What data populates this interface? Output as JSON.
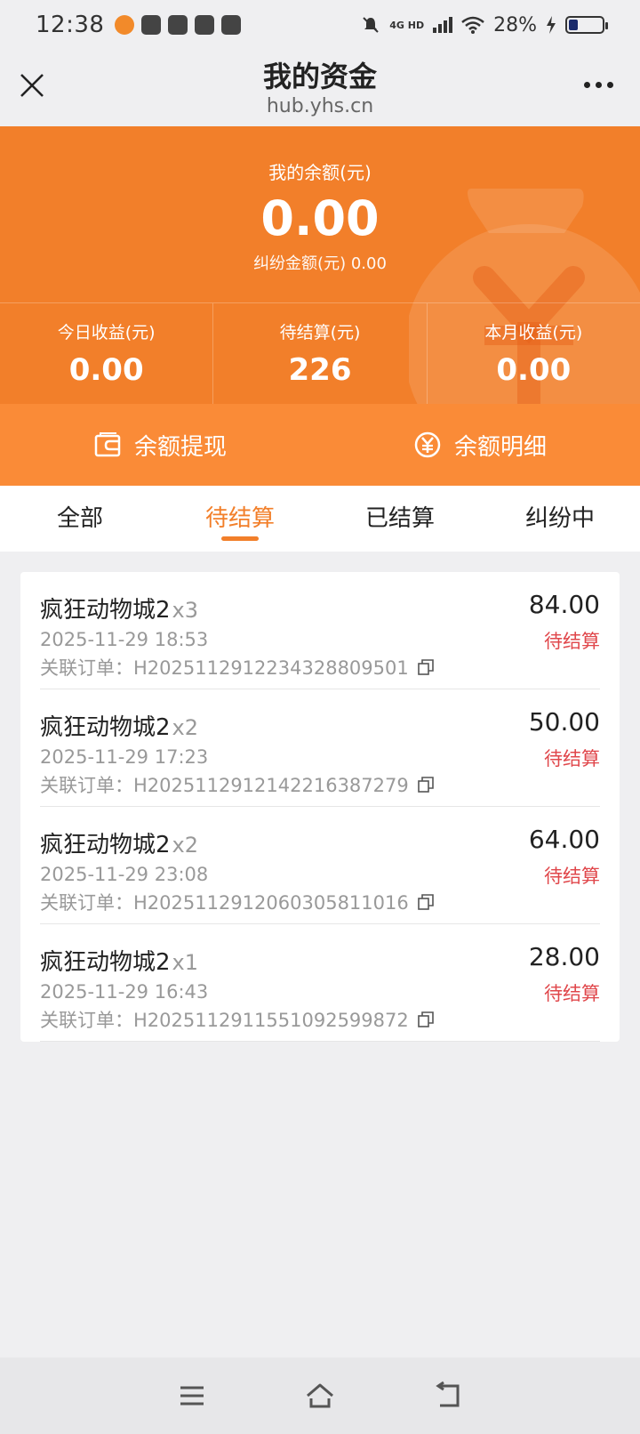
{
  "status_bar": {
    "time": "12:38",
    "network": "4G HD",
    "battery": "28%"
  },
  "header": {
    "title": "我的资金",
    "subtitle": "hub.yhs.cn"
  },
  "balance": {
    "label": "我的余额(元)",
    "amount": "0.00",
    "dispute_text": "纠纷金额(元) 0.00",
    "stats": [
      {
        "label": "今日收益(元)",
        "value": "0.00"
      },
      {
        "label": "待结算(元)",
        "value": "226"
      },
      {
        "label": "本月收益(元)",
        "value": "0.00"
      }
    ]
  },
  "actions": {
    "withdraw": "余额提现",
    "details": "余额明细"
  },
  "tabs": [
    "全部",
    "待结算",
    "已结算",
    "纠纷中"
  ],
  "active_tab": "待结算",
  "records": [
    {
      "name": "疯狂动物城2",
      "qty": "x3",
      "time": "2025-11-29 18:53",
      "order": "关联订单：H2025112912234328809501",
      "amount": "84.00",
      "status": "待结算"
    },
    {
      "name": "疯狂动物城2",
      "qty": "x2",
      "time": "2025-11-29 17:23",
      "order": "关联订单：H2025112912142216387279",
      "amount": "50.00",
      "status": "待结算"
    },
    {
      "name": "疯狂动物城2",
      "qty": "x2",
      "time": "2025-11-29 23:08",
      "order": "关联订单：H2025112912060305811016",
      "amount": "64.00",
      "status": "待结算"
    },
    {
      "name": "疯狂动物城2",
      "qty": "x1",
      "time": "2025-11-29 16:43",
      "order": "关联订单：H2025112911551092599872",
      "amount": "28.00",
      "status": "待结算"
    }
  ],
  "colors": {
    "primary_orange": "#f27f2a",
    "action_orange": "#fa8b37",
    "pending_red": "#e0474b"
  }
}
